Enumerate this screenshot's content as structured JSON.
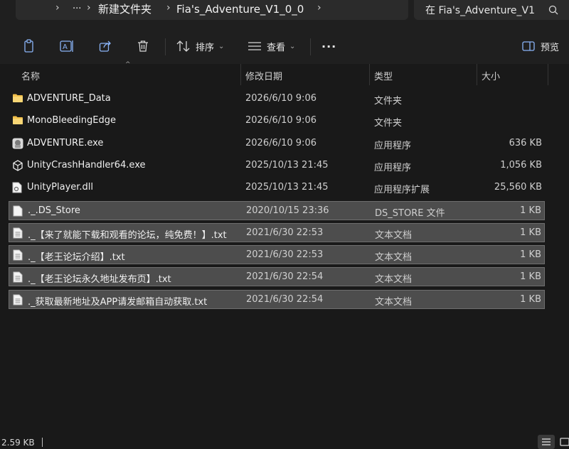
{
  "breadcrumb": {
    "more": "···",
    "items": [
      "新建文件夹",
      "Fia's_Adventure_V1_0_0"
    ]
  },
  "search": {
    "placeholder": "在 Fia's_Adventure_V1"
  },
  "toolbar": {
    "sort_label": "排序",
    "view_label": "查看",
    "more_label": "···",
    "preview_label": "预览"
  },
  "columns": {
    "name": "名称",
    "date": "修改日期",
    "type": "类型",
    "size": "大小"
  },
  "files": [
    {
      "name": "ADVENTURE_Data",
      "date": "2026/6/10 9:06",
      "type": "文件夹",
      "size": "",
      "icon": "folder-icon",
      "selected": false
    },
    {
      "name": "MonoBleedingEdge",
      "date": "2026/6/10 9:06",
      "type": "文件夹",
      "size": "",
      "icon": "folder-icon",
      "selected": false
    },
    {
      "name": "ADVENTURE.exe",
      "date": "2026/6/10 9:06",
      "type": "应用程序",
      "size": "636 KB",
      "icon": "game-app-icon",
      "selected": false
    },
    {
      "name": "UnityCrashHandler64.exe",
      "date": "2025/10/13 21:45",
      "type": "应用程序",
      "size": "1,056 KB",
      "icon": "unity-icon",
      "selected": false
    },
    {
      "name": "UnityPlayer.dll",
      "date": "2025/10/13 21:45",
      "type": "应用程序扩展",
      "size": "25,560 KB",
      "icon": "dll-file-icon",
      "selected": false
    },
    {
      "name": "._.DS_Store",
      "date": "2020/10/15 23:36",
      "type": "DS_STORE 文件",
      "size": "1 KB",
      "icon": "document-icon",
      "selected": true
    },
    {
      "name": "._【来了就能下载和观看的论坛，纯免费！】.txt",
      "date": "2021/6/30 22:53",
      "type": "文本文档",
      "size": "1 KB",
      "icon": "text-file-icon",
      "selected": true
    },
    {
      "name": "._【老王论坛介绍】.txt",
      "date": "2021/6/30 22:53",
      "type": "文本文档",
      "size": "1 KB",
      "icon": "text-file-icon",
      "selected": true
    },
    {
      "name": "._【老王论坛永久地址发布页】.txt",
      "date": "2021/6/30 22:54",
      "type": "文本文档",
      "size": "1 KB",
      "icon": "text-file-icon",
      "selected": true
    },
    {
      "name": "._获取最新地址及APP请发邮箱自动获取.txt",
      "date": "2021/6/30 22:54",
      "type": "文本文档",
      "size": "1 KB",
      "icon": "text-file-icon",
      "selected": true
    }
  ],
  "status": {
    "selection_size": "2.59 KB"
  },
  "colors": {
    "background": "#191919",
    "selection": "#4d4d4d",
    "folder": "#f2c04b"
  }
}
